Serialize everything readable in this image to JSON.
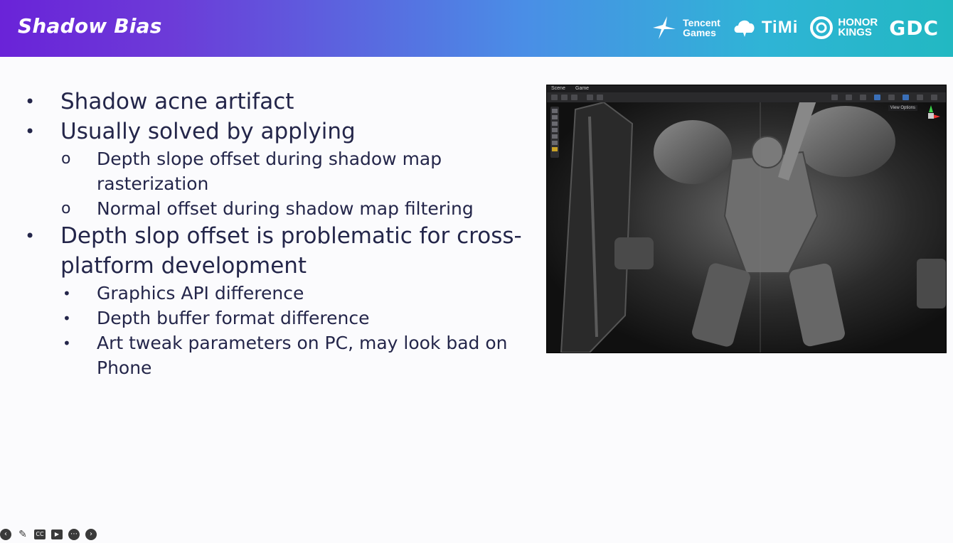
{
  "header": {
    "title": "Shadow Bias",
    "logos": {
      "tencent": "Tencent\nGames",
      "tencent_line1": "Tencent",
      "tencent_line2": "Games",
      "timi": "TiMi",
      "honor_line1": "HONOR",
      "honor_line2": "KINGS",
      "gdc": "GDC"
    }
  },
  "bullets": [
    {
      "level": 1,
      "text": "Shadow acne artifact"
    },
    {
      "level": 1,
      "text": "Usually solved by applying"
    },
    {
      "level": 2,
      "marker": "o",
      "text": "Depth slope offset during shadow map rasterization"
    },
    {
      "level": 2,
      "marker": "o",
      "text": "Normal offset during shadow map filtering"
    },
    {
      "level": 1,
      "text": "Depth slop offset is problematic for cross-platform development"
    },
    {
      "level": 2,
      "marker": "•",
      "text": "Graphics API difference"
    },
    {
      "level": 2,
      "marker": "•",
      "text": "Depth buffer format difference"
    },
    {
      "level": 2,
      "marker": "•",
      "text": "Art tweak parameters on PC, may look bad on Phone"
    }
  ],
  "viewport": {
    "tabs": [
      "Scene",
      "Game"
    ],
    "view_options": "View Options"
  },
  "player_controls": [
    "back-icon",
    "pen-icon",
    "captions-icon",
    "camera-off-icon",
    "more-icon",
    "forward-icon"
  ],
  "player_labels": {
    "cc": "CC"
  },
  "colors": {
    "header_left": "#6a23d8",
    "header_right": "#22b8c2",
    "text": "#24264a"
  }
}
